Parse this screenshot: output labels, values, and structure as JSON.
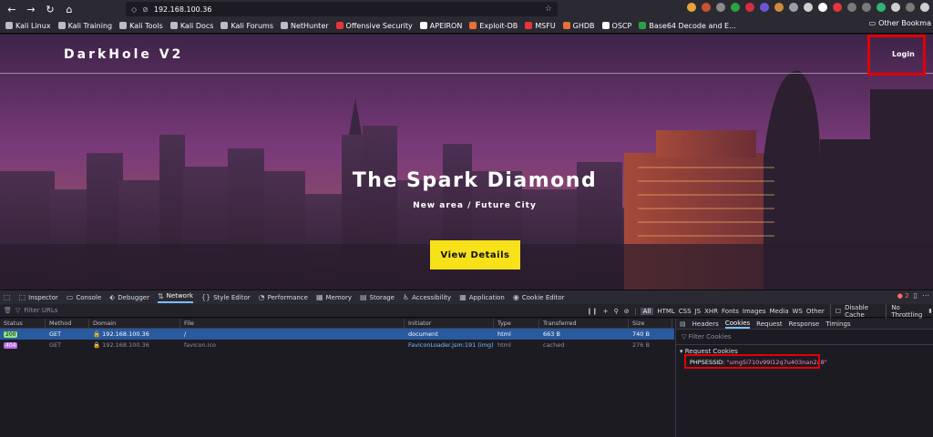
{
  "browser": {
    "url": "192.168.100.36",
    "bookmarks": [
      "Kali Linux",
      "Kali Training",
      "Kali Tools",
      "Kali Docs",
      "Kali Forums",
      "NetHunter",
      "Offensive Security",
      "APEIRON",
      "Exploit-DB",
      "MSFU",
      "GHDB",
      "OSCP",
      "Base64 Decode and E..."
    ],
    "other_bookmarks": "Other Bookma",
    "extension_colors": [
      "#e8a33d",
      "#c7542f",
      "#8b8b8b",
      "#2ea043",
      "#d92d3c",
      "#6b56d6",
      "#d08a3b",
      "#9aa0a6",
      "#cfcfcf",
      "#ffffff",
      "#e6353c",
      "#7a7a7a",
      "#7a7a7a",
      "#2bb673",
      "#cfcfcf",
      "#7a7a7a",
      "#cfcfcf"
    ]
  },
  "hero": {
    "brand": "DarkHole V2",
    "login": "Login",
    "title": "The Spark Diamond",
    "subtitle": "New area / Future City",
    "cta": "View Details"
  },
  "devtools": {
    "tabs": [
      "Inspector",
      "Console",
      "Debugger",
      "Network",
      "Style Editor",
      "Performance",
      "Memory",
      "Storage",
      "Accessibility",
      "Application",
      "Cookie Editor"
    ],
    "active_tab": "Network",
    "error_count": "2",
    "filter_placeholder": "Filter URLs",
    "type_filters": [
      "All",
      "HTML",
      "CSS",
      "JS",
      "XHR",
      "Fonts",
      "Images",
      "Media",
      "WS",
      "Other"
    ],
    "disable_cache": "Disable Cache",
    "throttling": "No Throttling",
    "columns": [
      "Status",
      "Method",
      "Domain",
      "File",
      "Initiator",
      "Type",
      "Transferred",
      "Size"
    ],
    "rows": [
      {
        "status": "200",
        "method": "GET",
        "domain": "192.168.100.36",
        "file": "/",
        "initiator": "document",
        "type": "html",
        "transferred": "663 B",
        "size": "740 B"
      },
      {
        "status": "404",
        "method": "GET",
        "domain": "192.168.100.36",
        "file": "favicon.ico",
        "initiator": "FaviconLoader.jsm:191 (img)",
        "type": "html",
        "transferred": "cached",
        "size": "276 B"
      }
    ],
    "side_tabs": [
      "Headers",
      "Cookies",
      "Request",
      "Response",
      "Timings"
    ],
    "side_active": "Cookies",
    "cookie_filter": "Filter Cookies",
    "request_cookies_label": "Request Cookies",
    "cookie_name": "PHPSESSID:",
    "cookie_value": "\"umg5i710v99l12q7u403nan2a8\""
  },
  "accent": {
    "highlight": "#e30000",
    "cta": "#f7e21a",
    "selected_row": "#2a5a9e"
  }
}
